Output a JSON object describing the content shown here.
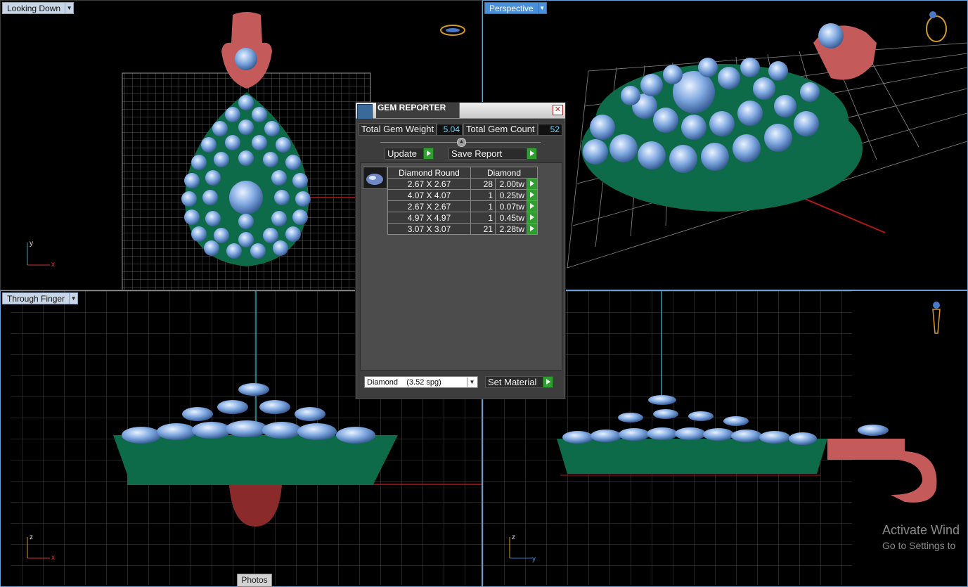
{
  "viewports": {
    "top_left": {
      "label": "Looking Down",
      "axis_v": "y",
      "axis_h": "x"
    },
    "top_right": {
      "label": "Perspective"
    },
    "bottom_left": {
      "label": "Through Finger",
      "axis_v": "z",
      "axis_h": "x"
    },
    "bottom_right": {
      "axis_v": "z",
      "axis_h": "y"
    }
  },
  "dialog": {
    "title": "GEM REPORTER",
    "close": "✕",
    "total_weight_label": "Total Gem Weight",
    "total_weight_value": "5.04",
    "total_count_label": "Total Gem Count",
    "total_count_value": "52",
    "update_label": "Update",
    "save_report_label": "Save Report",
    "table": {
      "headers": [
        "Diamond Round",
        "Diamond"
      ],
      "rows": [
        {
          "size": "2.67 X 2.67",
          "count": "28",
          "weight": "2.00tw"
        },
        {
          "size": "4.07 X 4.07",
          "count": "1",
          "weight": "0.25tw"
        },
        {
          "size": "2.67 X 2.67",
          "count": "1",
          "weight": "0.07tw"
        },
        {
          "size": "4.97 X 4.97",
          "count": "1",
          "weight": "0.45tw"
        },
        {
          "size": "3.07 X 3.07",
          "count": "21",
          "weight": "2.28tw"
        }
      ]
    },
    "material_select": "Diamond    (3.52 spg)",
    "set_material_label": "Set Material"
  },
  "photos_tab": "Photos",
  "watermark": {
    "line1": "Activate Wind",
    "line2": "Go to Settings to"
  },
  "colors": {
    "gem": "#7fa8e0",
    "metal_green": "#0e6b4a",
    "metal_red": "#c45a5a",
    "grid": "#8a8a8a",
    "accent": "#4a90d9"
  }
}
